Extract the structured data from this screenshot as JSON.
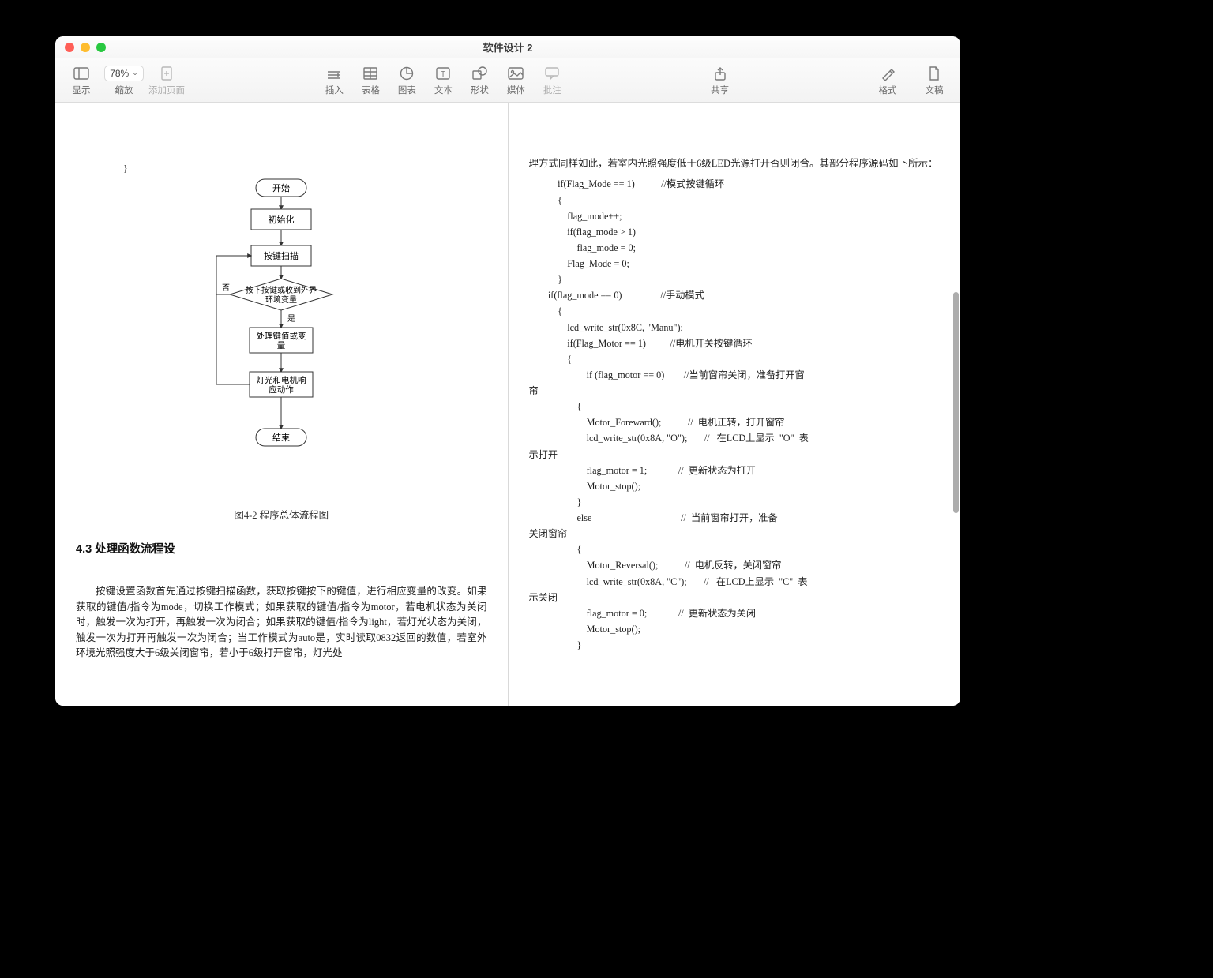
{
  "window": {
    "title": "软件设计 2"
  },
  "toolbar": {
    "view_label": "显示",
    "zoom_label": "缩放",
    "zoom_value": "78%",
    "addpage_label": "添加页面",
    "insert_label": "插入",
    "table_label": "表格",
    "chart_label": "图表",
    "text_label": "文本",
    "shape_label": "形状",
    "media_label": "媒体",
    "comment_label": "批注",
    "share_label": "共享",
    "format_label": "格式",
    "document_label": "文稿"
  },
  "left_page": {
    "brace_top": "}",
    "flow": {
      "start": "开始",
      "init": "初始化",
      "scan": "按键扫描",
      "cond_line1": "按下按键或收到外界",
      "cond_line2": "环境变量",
      "no": "否",
      "yes": "是",
      "process_line1": "处理键值或变",
      "process_line2": "量",
      "action_line1": "灯光和电机响",
      "action_line2": "应动作",
      "end": "结束"
    },
    "fig_caption": "图4-2   程序总体流程图",
    "heading": "4.3 处理函数流程设",
    "para": "按键设置函数首先通过按键扫描函数，获取按键按下的键值，进行相应变量的改变。如果获取的键值/指令为mode，切换工作模式；如果获取的键值/指令为motor，若电机状态为关闭时，触发一次为打开，再触发一次为闭合；如果获取的键值/指令为light，若灯光状态为关闭，触发一次为打开再触发一次为闭合；当工作模式为auto是，实时读取0832返回的数值，若室外环境光照强度大于6级关闭窗帘，若小于6级打开窗帘，灯光处"
  },
  "right_page": {
    "leadin": "理方式同样如此，若室内光照强度低于6级LED光源打开否则闭合。其部分程序源码如下所示：",
    "code": "            if(Flag_Mode == 1)           //模式按键循环\n            {\n                flag_mode++;\n                if(flag_mode > 1)\n                    flag_mode = 0;\n                Flag_Mode = 0;\n            }\n        if(flag_mode == 0)                //手动模式\n            {\n                lcd_write_str(0x8C, \"Manu\");\n                if(Flag_Motor == 1)          //电机开关按键循环\n                {\n                        if (flag_motor == 0)        //当前窗帘关闭，准备打开窗\n帘\n                    {\n                        Motor_Foreward();           //  电机正转，打开窗帘\n                        lcd_write_str(0x8A, \"O\");       //   在LCD上显示  \"O\"  表\n示打开\n                        flag_motor = 1;             //  更新状态为打开\n                        Motor_stop();\n                    }\n                    else                                     //  当前窗帘打开，准备\n关闭窗帘\n                    {\n                        Motor_Reversal();           //  电机反转，关闭窗帘\n                        lcd_write_str(0x8A, \"C\");       //   在LCD上显示  \"C\"  表\n示关闭\n                        flag_motor = 0;             //  更新状态为关闭\n                        Motor_stop();\n                    }"
  }
}
